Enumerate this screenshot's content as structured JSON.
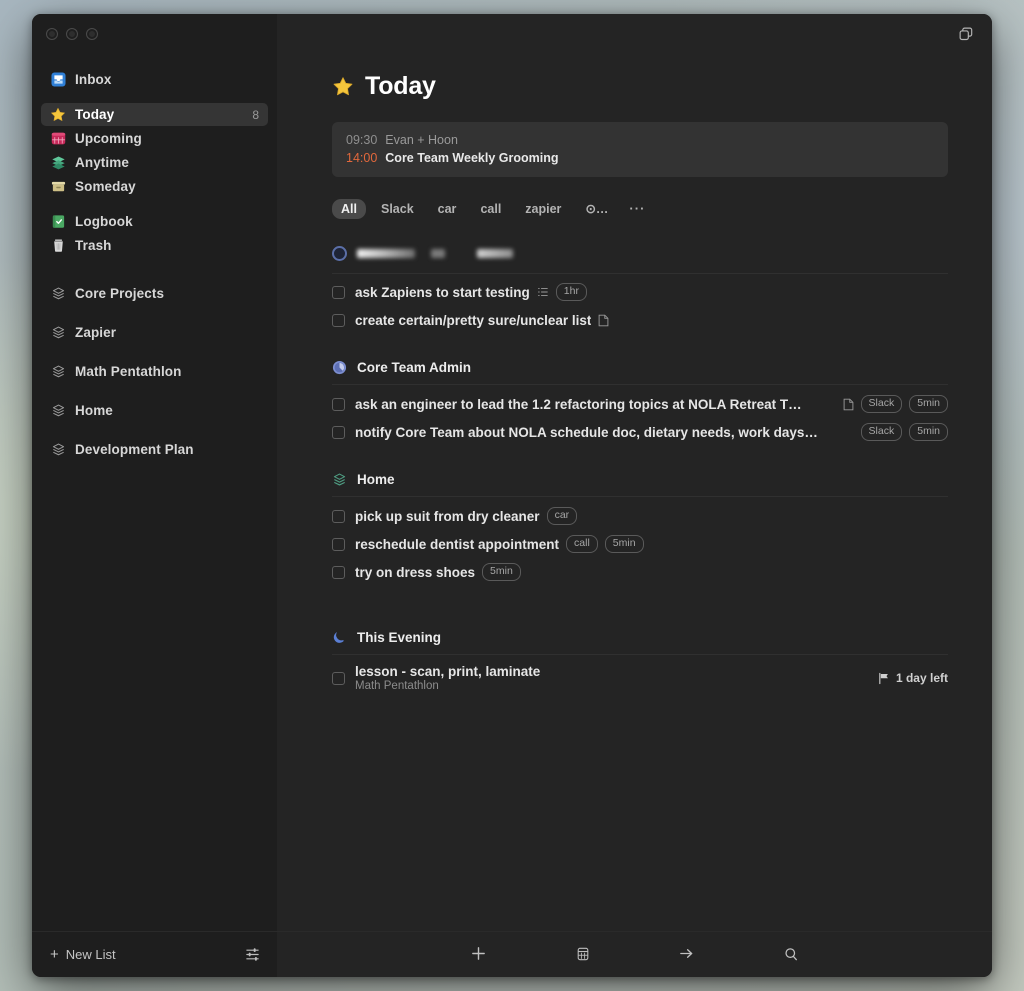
{
  "window": {
    "traffic_lights": [
      "close",
      "minimize",
      "zoom"
    ],
    "top_right_icon": "windows-duplicate-icon",
    "background_hex": "#242424",
    "sidebar_hex": "#1e1e1e"
  },
  "sidebar": {
    "items": [
      {
        "label": "Inbox",
        "icon": "inbox-tray-icon",
        "count": "",
        "selected": false
      },
      {
        "label": "Today",
        "icon": "star-icon",
        "count": "8",
        "selected": true
      },
      {
        "label": "Upcoming",
        "icon": "calendar-icon",
        "count": "",
        "selected": false
      },
      {
        "label": "Anytime",
        "icon": "layers-icon",
        "count": "",
        "selected": false
      },
      {
        "label": "Someday",
        "icon": "archive-box-icon",
        "count": "",
        "selected": false
      },
      {
        "label": "Logbook",
        "icon": "logbook-check-icon",
        "count": "",
        "selected": false
      },
      {
        "label": "Trash",
        "icon": "trash-icon",
        "count": "",
        "selected": false
      }
    ],
    "projects": [
      {
        "label": "Core Projects",
        "icon": "project-hex-icon"
      },
      {
        "label": "Zapier",
        "icon": "project-hex-icon"
      },
      {
        "label": "Math Pentathlon",
        "icon": "project-hex-icon"
      },
      {
        "label": "Home",
        "icon": "project-hex-icon"
      },
      {
        "label": "Development Plan",
        "icon": "project-hex-icon"
      }
    ],
    "footer": {
      "new_list_label": "New List",
      "new_list_icon": "plus-icon",
      "settings_icon": "sliders-icon"
    }
  },
  "main": {
    "title": "Today",
    "title_icon": "star-icon",
    "calendar": {
      "events": [
        {
          "time": "09:30",
          "name": "Evan + Hoon",
          "current": false
        },
        {
          "time": "14:00",
          "name": "Core Team Weekly Grooming",
          "current": true
        }
      ]
    },
    "filters": {
      "chips": [
        {
          "label": "All",
          "active": true,
          "kind": "text"
        },
        {
          "label": "Slack",
          "active": false,
          "kind": "text"
        },
        {
          "label": "car",
          "active": false,
          "kind": "text"
        },
        {
          "label": "call",
          "active": false,
          "kind": "text"
        },
        {
          "label": "zapier",
          "active": false,
          "kind": "text"
        },
        {
          "label": "⊙…",
          "active": false,
          "kind": "text"
        },
        {
          "label": "···",
          "active": false,
          "kind": "more"
        }
      ]
    },
    "redacted_group": {
      "icon": "progress-ring-icon",
      "note": "blurred project title"
    },
    "sections": [
      {
        "header": null,
        "tasks": [
          {
            "text": "ask Zapiens to start testing",
            "subtitle": "",
            "inline_icons": [
              "checklist-icon"
            ],
            "tags": [
              "1hr"
            ],
            "deadline": ""
          },
          {
            "text": "create certain/pretty sure/unclear list",
            "subtitle": "",
            "inline_icons": [
              "note-icon"
            ],
            "tags": [],
            "deadline": ""
          }
        ]
      },
      {
        "header": {
          "title": "Core Team Admin",
          "icon": "progress-ring-icon",
          "color": "#6b7fc4"
        },
        "tasks": [
          {
            "text": "ask an engineer to lead the 1.2 refactoring topics at NOLA Retreat T…",
            "subtitle": "",
            "inline_icons": [
              "note-icon"
            ],
            "tags": [
              "Slack",
              "5min"
            ],
            "deadline": ""
          },
          {
            "text": "notify Core Team about NOLA schedule doc, dietary needs, work days…",
            "subtitle": "",
            "inline_icons": [],
            "tags": [
              "Slack",
              "5min"
            ],
            "deadline": ""
          }
        ]
      },
      {
        "header": {
          "title": "Home",
          "icon": "project-hex-icon",
          "color": "#4f9e83"
        },
        "tasks": [
          {
            "text": "pick up suit from dry cleaner",
            "subtitle": "",
            "inline_icons": [],
            "tags": [
              "car"
            ],
            "deadline": ""
          },
          {
            "text": "reschedule dentist appointment",
            "subtitle": "",
            "inline_icons": [],
            "tags": [
              "call",
              "5min"
            ],
            "deadline": ""
          },
          {
            "text": "try on dress shoes",
            "subtitle": "",
            "inline_icons": [],
            "tags": [
              "5min"
            ],
            "deadline": ""
          }
        ]
      },
      {
        "header": {
          "title": "This Evening",
          "icon": "moon-icon",
          "color": "#5b7fd4"
        },
        "tasks": [
          {
            "text": "lesson - scan, print, laminate",
            "subtitle": "Math Pentathlon",
            "inline_icons": [],
            "tags": [],
            "deadline": "1 day left",
            "deadline_icon": "flag-icon"
          }
        ]
      }
    ],
    "footer": {
      "buttons": [
        {
          "icon": "plus-icon",
          "label": "New To-Do"
        },
        {
          "icon": "calendar-icon",
          "label": "When"
        },
        {
          "icon": "arrow-right-icon",
          "label": "Move"
        },
        {
          "icon": "search-icon",
          "label": "Search"
        }
      ]
    }
  }
}
